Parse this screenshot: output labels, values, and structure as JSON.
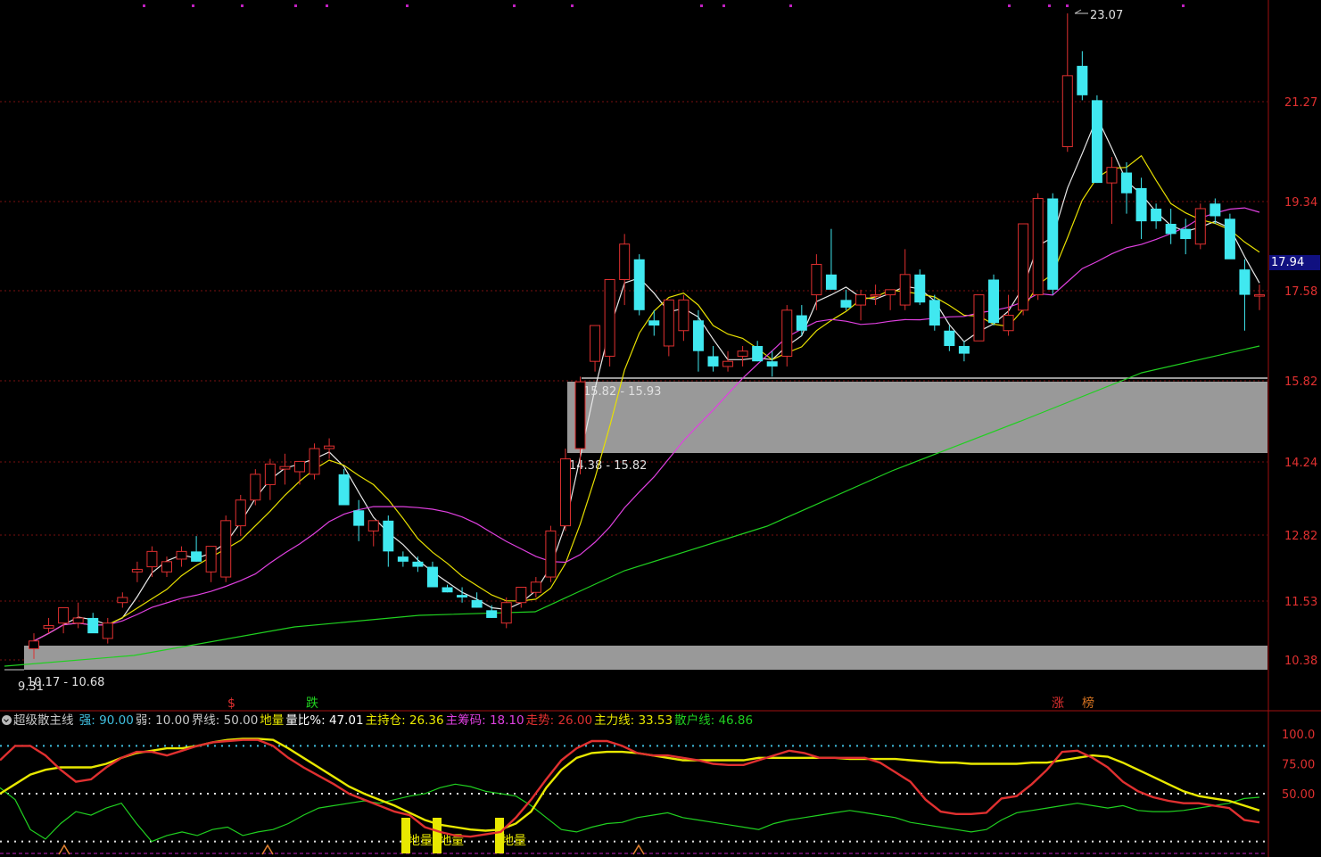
{
  "chart_data": [
    {
      "type": "candlestick",
      "title": "",
      "y_ticks": [
        "21.27",
        "19.34",
        "17.58",
        "15.82",
        "14.24",
        "12.82",
        "11.53",
        "10.38"
      ],
      "last_price_label": "17.94",
      "high_label": "23.07",
      "low_label": "9.31",
      "zones": [
        {
          "label_top": "15.82 - 15.93",
          "label_bottom": "14.38 - 15.82",
          "low": 14.38,
          "high": 15.93
        },
        {
          "label": "10.17 - 10.68",
          "low": 10.17,
          "high": 10.68
        }
      ],
      "markers": [
        {
          "text": "$",
          "color": "#e03030"
        },
        {
          "text": "跌",
          "color": "#20d020"
        },
        {
          "text": "涨",
          "color": "#e03030"
        },
        {
          "text": "榜",
          "color": "#d07020"
        }
      ],
      "candles_ohlc": [
        [
          10.6,
          10.9,
          10.4,
          10.75
        ],
        [
          11.0,
          11.2,
          10.9,
          11.05
        ],
        [
          11.1,
          11.4,
          10.9,
          11.4
        ],
        [
          11.1,
          11.5,
          11.0,
          11.2
        ],
        [
          11.2,
          11.3,
          11.0,
          10.9
        ],
        [
          10.8,
          11.2,
          10.7,
          11.1
        ],
        [
          11.5,
          11.7,
          11.4,
          11.6
        ],
        [
          12.1,
          12.3,
          11.9,
          12.15
        ],
        [
          12.2,
          12.6,
          12.0,
          12.5
        ],
        [
          12.1,
          12.4,
          12.0,
          12.3
        ],
        [
          12.35,
          12.6,
          12.2,
          12.5
        ],
        [
          12.5,
          12.8,
          12.3,
          12.3
        ],
        [
          12.1,
          12.6,
          11.9,
          12.6
        ],
        [
          12.0,
          13.2,
          11.9,
          13.1
        ],
        [
          13.0,
          13.6,
          12.8,
          13.5
        ],
        [
          13.5,
          14.1,
          13.4,
          14.0
        ],
        [
          13.8,
          14.3,
          13.5,
          14.2
        ],
        [
          14.1,
          14.4,
          13.8,
          14.15
        ],
        [
          14.05,
          14.2,
          13.8,
          14.25
        ],
        [
          14.0,
          14.6,
          13.9,
          14.5
        ],
        [
          14.5,
          14.7,
          14.3,
          14.55
        ],
        [
          14.0,
          14.1,
          13.4,
          13.4
        ],
        [
          13.3,
          13.5,
          12.7,
          13.0
        ],
        [
          12.9,
          13.1,
          12.6,
          13.1
        ],
        [
          13.1,
          13.2,
          12.2,
          12.5
        ],
        [
          12.4,
          12.5,
          12.2,
          12.3
        ],
        [
          12.3,
          12.4,
          12.1,
          12.2
        ],
        [
          12.2,
          12.3,
          11.9,
          11.8
        ],
        [
          11.8,
          11.85,
          11.7,
          11.7
        ],
        [
          11.65,
          11.8,
          11.5,
          11.6
        ],
        [
          11.55,
          11.7,
          11.4,
          11.4
        ],
        [
          11.35,
          11.45,
          11.2,
          11.2
        ],
        [
          11.1,
          11.6,
          11.0,
          11.5
        ],
        [
          11.5,
          11.8,
          11.4,
          11.8
        ],
        [
          11.7,
          12.0,
          11.6,
          11.9
        ],
        [
          12.0,
          13.0,
          11.9,
          12.9
        ],
        [
          13.0,
          14.5,
          12.9,
          14.3
        ],
        [
          14.5,
          15.9,
          14.0,
          15.8
        ],
        [
          16.2,
          16.6,
          16.0,
          16.9
        ],
        [
          16.3,
          17.8,
          16.1,
          17.8
        ],
        [
          17.8,
          18.7,
          17.3,
          18.5
        ],
        [
          18.2,
          18.3,
          17.1,
          17.2
        ],
        [
          17.0,
          17.2,
          16.7,
          16.9
        ],
        [
          16.5,
          17.3,
          16.3,
          17.4
        ],
        [
          16.8,
          17.5,
          16.6,
          17.4
        ],
        [
          17.0,
          17.2,
          16.0,
          16.4
        ],
        [
          16.3,
          16.5,
          16.0,
          16.1
        ],
        [
          16.1,
          16.4,
          16.0,
          16.2
        ],
        [
          16.3,
          16.5,
          16.1,
          16.4
        ],
        [
          16.5,
          16.6,
          16.2,
          16.2
        ],
        [
          16.2,
          16.4,
          15.9,
          16.1
        ],
        [
          16.3,
          17.3,
          16.1,
          17.2
        ],
        [
          17.1,
          17.3,
          16.7,
          16.8
        ],
        [
          17.5,
          18.3,
          17.2,
          18.1
        ],
        [
          17.9,
          18.8,
          17.6,
          17.6
        ],
        [
          17.4,
          17.6,
          17.2,
          17.25
        ],
        [
          17.3,
          17.6,
          17.0,
          17.5
        ],
        [
          17.5,
          17.7,
          17.3,
          17.5
        ],
        [
          17.5,
          17.6,
          17.2,
          17.6
        ],
        [
          17.3,
          18.4,
          17.2,
          17.9
        ],
        [
          17.9,
          18.0,
          17.3,
          17.35
        ],
        [
          17.4,
          17.5,
          16.8,
          16.9
        ],
        [
          16.8,
          16.9,
          16.4,
          16.5
        ],
        [
          16.5,
          16.6,
          16.2,
          16.35
        ],
        [
          16.6,
          17.5,
          16.6,
          17.5
        ],
        [
          17.8,
          17.9,
          16.9,
          16.95
        ],
        [
          16.8,
          17.5,
          16.7,
          17.1
        ],
        [
          17.2,
          18.9,
          17.1,
          18.9
        ],
        [
          17.5,
          19.5,
          17.4,
          19.4
        ],
        [
          19.4,
          19.5,
          17.5,
          17.6
        ],
        [
          20.4,
          23.07,
          20.3,
          21.8
        ],
        [
          22.0,
          22.3,
          21.3,
          21.4
        ],
        [
          21.3,
          21.4,
          19.7,
          19.7
        ],
        [
          19.7,
          20.2,
          18.9,
          20.0
        ],
        [
          19.9,
          20.1,
          19.1,
          19.5
        ],
        [
          19.6,
          19.8,
          18.6,
          18.95
        ],
        [
          19.2,
          19.3,
          18.8,
          18.95
        ],
        [
          18.9,
          19.2,
          18.5,
          18.7
        ],
        [
          18.8,
          19.0,
          18.3,
          18.6
        ],
        [
          18.5,
          19.3,
          18.4,
          19.2
        ],
        [
          19.3,
          19.4,
          18.9,
          19.05
        ],
        [
          19.0,
          19.1,
          18.6,
          18.2
        ],
        [
          18.0,
          18.2,
          16.8,
          17.5
        ],
        [
          17.5,
          17.7,
          17.2,
          17.5
        ]
      ]
    },
    {
      "type": "line",
      "title": "超级散主线",
      "indicators": [
        {
          "name": "强",
          "value": "90.00",
          "color": "#40c0e0"
        },
        {
          "name": "弱",
          "value": "10.00",
          "color": "#c8c8c8"
        },
        {
          "name": "界线",
          "value": "50.00",
          "color": "#c8c8c8"
        },
        {
          "name": "地量",
          "value": "",
          "color": "#e8e800"
        },
        {
          "name": "量比%",
          "value": "47.01",
          "color": "#ffffff"
        },
        {
          "name": "主持仓",
          "value": "26.36",
          "color": "#e8e800"
        },
        {
          "name": "主筹码",
          "value": "18.10",
          "color": "#e040e0"
        },
        {
          "name": "走势",
          "value": "26.00",
          "color": "#e03030"
        },
        {
          "name": "主力线",
          "value": "33.53",
          "color": "#e8e800"
        },
        {
          "name": "散户线",
          "value": "46.86",
          "color": "#20d020"
        }
      ],
      "y_ticks": [
        "100.0",
        "75.00",
        "50.00"
      ],
      "dimei_label": "地量",
      "series": [
        {
          "name": "走势",
          "color": "#e03030",
          "values": [
            78,
            90,
            90,
            82,
            70,
            60,
            62,
            72,
            80,
            85,
            85,
            82,
            86,
            90,
            93,
            94,
            95,
            95,
            90,
            80,
            72,
            65,
            58,
            50,
            45,
            40,
            35,
            32,
            22,
            18,
            15,
            14,
            16,
            18,
            30,
            45,
            62,
            78,
            88,
            94,
            94,
            90,
            84,
            82,
            82,
            80,
            78,
            75,
            74,
            74,
            78,
            82,
            86,
            84,
            80,
            80,
            80,
            80,
            76,
            68,
            60,
            45,
            35,
            33,
            33,
            34,
            46,
            48,
            58,
            70,
            85,
            86,
            80,
            72,
            60,
            52,
            47,
            44,
            42,
            42,
            40,
            38,
            28,
            26
          ]
        },
        {
          "name": "主力线",
          "color": "#e8e800",
          "values": [
            50,
            58,
            66,
            70,
            72,
            72,
            72,
            75,
            80,
            84,
            86,
            88,
            88,
            90,
            93,
            95,
            96,
            96,
            95,
            88,
            80,
            72,
            64,
            56,
            50,
            45,
            40,
            34,
            28,
            24,
            22,
            20,
            19,
            20,
            25,
            35,
            55,
            70,
            80,
            84,
            85,
            85,
            84,
            82,
            80,
            78,
            78,
            78,
            78,
            78,
            80,
            80,
            80,
            80,
            80,
            80,
            79,
            79,
            79,
            79,
            78,
            77,
            76,
            76,
            75,
            75,
            75,
            75,
            76,
            76,
            78,
            80,
            82,
            81,
            76,
            70,
            64,
            58,
            52,
            48,
            46,
            44,
            40,
            36
          ]
        },
        {
          "name": "散户线",
          "color": "#20d020",
          "values": [
            55,
            45,
            20,
            12,
            25,
            35,
            32,
            38,
            42,
            25,
            10,
            15,
            18,
            15,
            20,
            22,
            15,
            18,
            20,
            25,
            32,
            38,
            40,
            42,
            44,
            42,
            45,
            48,
            50,
            55,
            58,
            56,
            52,
            50,
            48,
            40,
            30,
            20,
            18,
            22,
            25,
            26,
            30,
            32,
            34,
            30,
            28,
            26,
            24,
            22,
            20,
            25,
            28,
            30,
            32,
            34,
            36,
            34,
            32,
            30,
            26,
            24,
            22,
            20,
            18,
            20,
            28,
            34,
            36,
            38,
            40,
            42,
            40,
            38,
            40,
            36,
            35,
            35,
            36,
            38,
            40,
            42,
            46,
            47
          ]
        }
      ]
    }
  ]
}
